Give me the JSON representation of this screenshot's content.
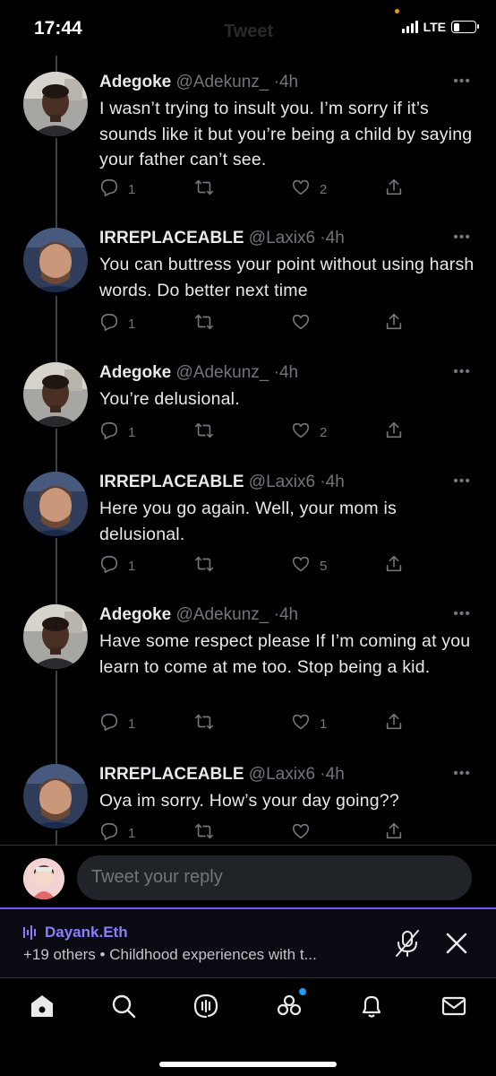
{
  "status": {
    "time": "17:44",
    "network": "LTE",
    "battery_level": 0.3
  },
  "ghost_title": "Tweet",
  "tweets": [
    {
      "name": "Adegoke",
      "handle": "@Adekunz_",
      "time": "4h",
      "text": "I wasn’t trying to insult you. I’m sorry if it’s sounds like it but you’re being a child by saying your father can’t see.",
      "replies": "1",
      "retweets": "",
      "likes": "2",
      "avatar": "man-avatar"
    },
    {
      "name": "IRREPLACEABLE",
      "handle": "@Laxix6",
      "time": "4h",
      "text": "You can buttress your point without using harsh words. Do better next time",
      "replies": "1",
      "retweets": "",
      "likes": "",
      "avatar": "footballer-avatar"
    },
    {
      "name": "Adegoke",
      "handle": "@Adekunz_",
      "time": "4h",
      "text": "You’re delusional.",
      "replies": "1",
      "retweets": "",
      "likes": "2",
      "avatar": "man-avatar"
    },
    {
      "name": "IRREPLACEABLE",
      "handle": "@Laxix6",
      "time": "4h",
      "text": "Here you go again. Well, your mom is delusional.",
      "replies": "1",
      "retweets": "",
      "likes": "5",
      "avatar": "footballer-avatar"
    },
    {
      "name": "Adegoke",
      "handle": "@Adekunz_",
      "time": "4h",
      "text": "Have some respect please If I’m coming at you learn to come at me too. Stop being a kid.",
      "replies": "1",
      "retweets": "",
      "likes": "1",
      "avatar": "man-avatar"
    },
    {
      "name": "IRREPLACEABLE",
      "handle": "@Laxix6",
      "time": "4h",
      "text": "Oya im sorry. How’s your day going??",
      "replies": "1",
      "retweets": "",
      "likes": "",
      "avatar": "footballer-avatar"
    }
  ],
  "reply_bar": {
    "placeholder": "Tweet your reply"
  },
  "space": {
    "host": "Dayank.Eth",
    "subtitle": "+19 others • Childhood experiences with t..."
  },
  "tabs": [
    "home-icon",
    "search-icon",
    "spaces-icon",
    "communities-icon",
    "notifications-icon",
    "messages-icon"
  ],
  "colors": {
    "background": "#000000",
    "text": "#e7e9ea",
    "secondary": "#71767b",
    "spaces_accent": "#7856ff",
    "blue": "#1d9bf0"
  }
}
